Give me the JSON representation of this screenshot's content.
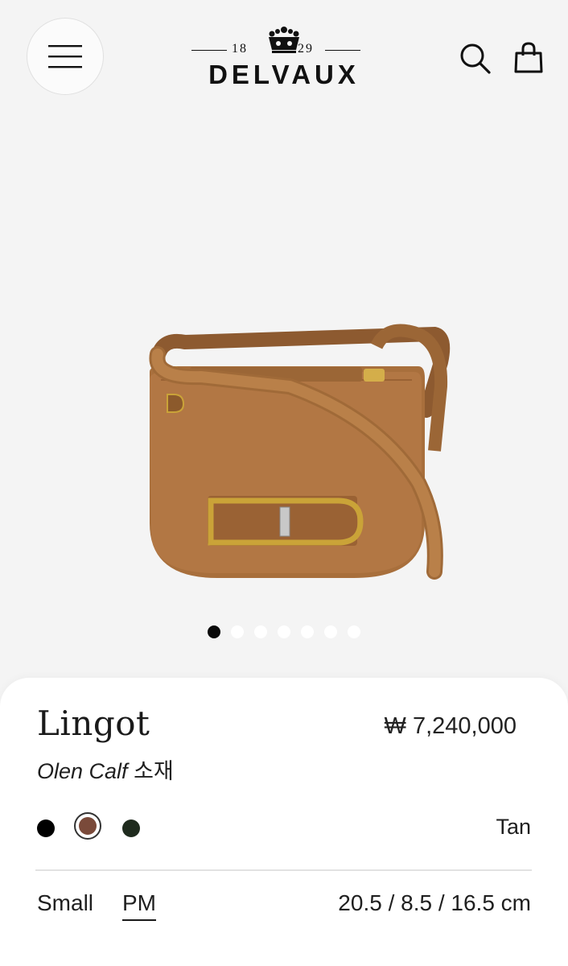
{
  "header": {
    "brand": "DELVAUX",
    "year_left": "18",
    "year_right": "29",
    "icons": [
      "menu-icon",
      "search-icon",
      "shopping-bag-icon"
    ]
  },
  "gallery": {
    "image_alt": "Tan leather Lingot shoulder bag with gold buckle",
    "total_slides": 7,
    "active_slide": 1
  },
  "product": {
    "name": "Lingot",
    "price": "₩ 7,240,000",
    "material_italic": "Olen Calf",
    "material_suffix": " 소재",
    "selected_color_name": "Tan",
    "colors": [
      {
        "name": "black",
        "hex": "#000000"
      },
      {
        "name": "tan",
        "hex": "#7a4a3a"
      },
      {
        "name": "green",
        "hex": "#1f2b1e"
      }
    ],
    "size_label": "Small",
    "size_option": "PM",
    "dimensions": "20.5 / 8.5 / 16.5 cm"
  },
  "colors": {
    "background": "#f4f4f4",
    "sheet": "#ffffff",
    "leather": "#a86f3c",
    "gold": "#caa338"
  }
}
